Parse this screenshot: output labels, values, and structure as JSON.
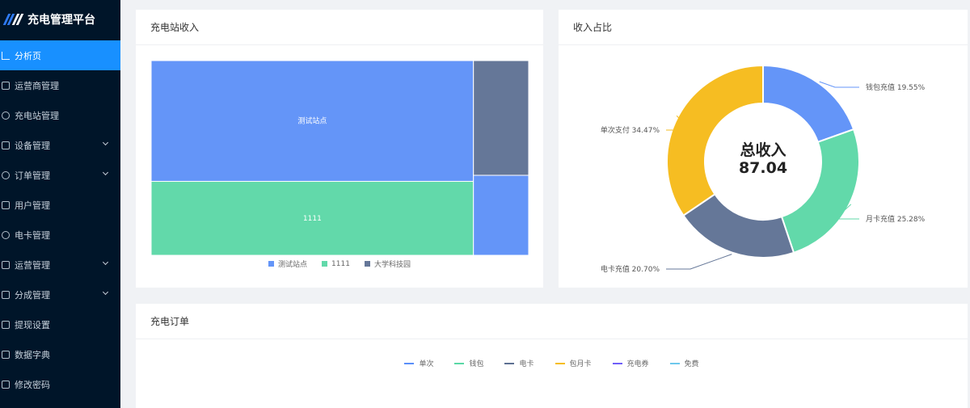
{
  "app": {
    "title": "充电管理平台"
  },
  "sidebar": {
    "items": [
      {
        "label": "分析页",
        "icon": "chart-line-icon",
        "active": true,
        "has_arrow": false
      },
      {
        "label": "运营商管理",
        "icon": "operator-icon",
        "active": false,
        "has_arrow": false
      },
      {
        "label": "充电站管理",
        "icon": "station-icon",
        "active": false,
        "has_arrow": false
      },
      {
        "label": "设备管理",
        "icon": "device-icon",
        "active": false,
        "has_arrow": true
      },
      {
        "label": "订单管理",
        "icon": "order-icon",
        "active": false,
        "has_arrow": true
      },
      {
        "label": "用户管理",
        "icon": "user-icon",
        "active": false,
        "has_arrow": false
      },
      {
        "label": "电卡管理",
        "icon": "card-icon",
        "active": false,
        "has_arrow": false
      },
      {
        "label": "运营管理",
        "icon": "operation-icon",
        "active": false,
        "has_arrow": true
      },
      {
        "label": "分成管理",
        "icon": "share-icon",
        "active": false,
        "has_arrow": true
      },
      {
        "label": "提现设置",
        "icon": "withdraw-icon",
        "active": false,
        "has_arrow": false
      },
      {
        "label": "数据字典",
        "icon": "dictionary-icon",
        "active": false,
        "has_arrow": false
      },
      {
        "label": "修改密码",
        "icon": "lock-icon",
        "active": false,
        "has_arrow": false
      }
    ]
  },
  "station_income": {
    "title": "充电站收入",
    "legend": [
      "测试站点",
      "1111",
      "大学科技园"
    ]
  },
  "income_ratio": {
    "title": "收入占比",
    "center_label": "总收入",
    "center_value": "87.04"
  },
  "orders": {
    "title": "充电订单",
    "legend": [
      {
        "label": "单次",
        "color": "#5b8ff9"
      },
      {
        "label": "钱包",
        "color": "#5ad8a6"
      },
      {
        "label": "电卡",
        "color": "#5d7092"
      },
      {
        "label": "包月卡",
        "color": "#f6bd16"
      },
      {
        "label": "充电券",
        "color": "#6f5ef9"
      },
      {
        "label": "免费",
        "color": "#6dc8ec"
      }
    ]
  },
  "chart_data": [
    {
      "type": "treemap",
      "title": "充电站收入",
      "nodes": [
        {
          "name": "测试站点",
          "value": 46.7,
          "color": "#6495f8",
          "label": "测试站点"
        },
        {
          "name": "1111",
          "value": 28.6,
          "color": "#62d9aa",
          "label": "1111"
        },
        {
          "name": "大学科技园",
          "value": 7.6,
          "color": "#657798",
          "label": ""
        },
        {
          "name": "",
          "value": 5.3,
          "color": "#6495f8",
          "label": ""
        }
      ]
    },
    {
      "type": "pie",
      "title": "收入占比",
      "slices": [
        {
          "name": "钱包充值",
          "value": 19.55,
          "label": "钱包充值 19.55%",
          "color": "#6495f8"
        },
        {
          "name": "月卡充值",
          "value": 25.28,
          "label": "月卡充值 25.28%",
          "color": "#62d9aa"
        },
        {
          "name": "电卡充值",
          "value": 20.7,
          "label": "电卡充值 20.70%",
          "color": "#657798"
        },
        {
          "name": "单次支付",
          "value": 34.47,
          "label": "单次支付 34.47%",
          "color": "#f6bd22"
        }
      ]
    }
  ]
}
